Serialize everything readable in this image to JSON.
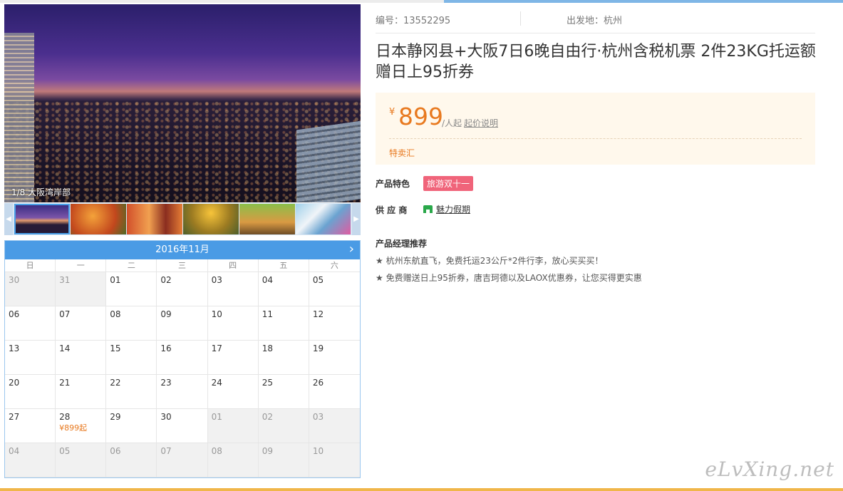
{
  "gallery": {
    "caption": "1/8 大阪湾岸部",
    "thumbnails": [
      "thumb-1",
      "thumb-2",
      "thumb-3",
      "thumb-4",
      "thumb-5",
      "thumb-6"
    ]
  },
  "calendar": {
    "month_label": "2016年11月",
    "weekdays": [
      "日",
      "一",
      "二",
      "三",
      "四",
      "五",
      "六"
    ],
    "days": [
      {
        "d": "30",
        "out": true
      },
      {
        "d": "31",
        "out": true
      },
      {
        "d": "01"
      },
      {
        "d": "02"
      },
      {
        "d": "03"
      },
      {
        "d": "04"
      },
      {
        "d": "05"
      },
      {
        "d": "06"
      },
      {
        "d": "07"
      },
      {
        "d": "08"
      },
      {
        "d": "09"
      },
      {
        "d": "10"
      },
      {
        "d": "11"
      },
      {
        "d": "12"
      },
      {
        "d": "13"
      },
      {
        "d": "14"
      },
      {
        "d": "15"
      },
      {
        "d": "16"
      },
      {
        "d": "17"
      },
      {
        "d": "18"
      },
      {
        "d": "19"
      },
      {
        "d": "20"
      },
      {
        "d": "21"
      },
      {
        "d": "22"
      },
      {
        "d": "23"
      },
      {
        "d": "24"
      },
      {
        "d": "25"
      },
      {
        "d": "26"
      },
      {
        "d": "27"
      },
      {
        "d": "28",
        "price": "¥899起"
      },
      {
        "d": "29"
      },
      {
        "d": "30"
      },
      {
        "d": "01",
        "out": true
      },
      {
        "d": "02",
        "out": true
      },
      {
        "d": "03",
        "out": true
      },
      {
        "d": "04",
        "out": true
      },
      {
        "d": "05",
        "out": true
      },
      {
        "d": "06",
        "out": true
      },
      {
        "d": "07",
        "out": true
      },
      {
        "d": "08",
        "out": true
      },
      {
        "d": "09",
        "out": true
      },
      {
        "d": "10",
        "out": true
      }
    ]
  },
  "product": {
    "code": "编号：13552295",
    "departure": "出发地：杭州",
    "title": "日本静冈县+大阪7日6晚自由行·杭州含税机票 2件23KG托运额 赠日上95折券",
    "currency": "¥",
    "price": "899",
    "price_unit": "/人起",
    "price_explain": "起价说明",
    "promo": "特卖汇",
    "feature_label": "产品特色",
    "feature_tag": "旅游双十一",
    "supplier_label": "供 应 商",
    "supplier_name": "魅力假期",
    "recommend_title": "产品经理推荐",
    "recommend": [
      "★ 杭州东航直飞，免费托运23公斤*2件行李，放心买买买！",
      "★ 免费赠送日上95折券，唐吉珂德以及LAOX优惠券，让您买得更实惠"
    ]
  },
  "watermark": "eLvXing.net",
  "colors": {
    "accent_blue": "#4a9be5",
    "price_orange": "#e8791f",
    "tag_pink": "#f0647a",
    "price_bg": "#fff8ec"
  }
}
